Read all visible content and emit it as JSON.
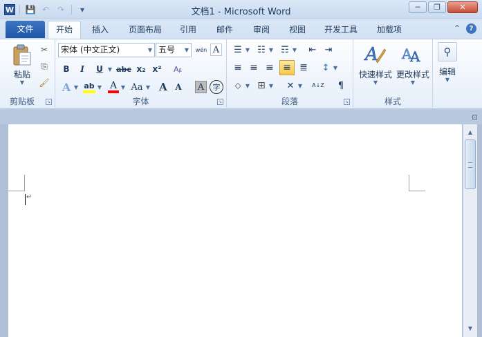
{
  "window": {
    "title": "文档1 - Microsoft Word",
    "app_icon_letter": "W"
  },
  "qat": {
    "save": "💾",
    "undo": "↶",
    "redo": "↷",
    "customize": "▾"
  },
  "window_controls": {
    "minimize": "─",
    "restore": "❐",
    "close": "✕"
  },
  "tabs": [
    {
      "label": "文件"
    },
    {
      "label": "开始"
    },
    {
      "label": "插入"
    },
    {
      "label": "页面布局"
    },
    {
      "label": "引用"
    },
    {
      "label": "邮件"
    },
    {
      "label": "审阅"
    },
    {
      "label": "视图"
    },
    {
      "label": "开发工具"
    },
    {
      "label": "加载项"
    }
  ],
  "tab_right": {
    "collapse": "⌃",
    "help": "?"
  },
  "clipboard": {
    "label": "剪贴板",
    "paste": "粘贴",
    "cut": "✂",
    "copy": "⎘",
    "format_painter": "🖌"
  },
  "font": {
    "label": "字体",
    "font_name": "宋体 (中文正文)",
    "font_size": "五号",
    "phonetic": "wén",
    "char_border": "A",
    "bold": "B",
    "italic": "I",
    "underline": "U",
    "strike": "abc",
    "subscript": "x₂",
    "superscript": "x²",
    "clear": "Aᵦ",
    "text_effect": "A",
    "highlight": "ab",
    "font_color": "A",
    "case": "Aa",
    "grow": "A",
    "shrink": "A",
    "shading": "A",
    "enclose": "字"
  },
  "paragraph": {
    "label": "段落",
    "bullets": "☰",
    "numbering": "☷",
    "multilevel": "☶",
    "decrease_indent": "⇤",
    "increase_indent": "⇥",
    "align_left": "≡",
    "center": "≡",
    "align_right": "≡",
    "justify": "≡",
    "distributed": "≣",
    "line_spacing": "↕",
    "shading": "⬦",
    "borders": "⊞",
    "chinese_layout": "✕",
    "sort": "A↓Z",
    "show_marks": "¶"
  },
  "styles": {
    "label": "样式",
    "quick_styles": "快速样式",
    "change_styles": "更改样式"
  },
  "editing": {
    "label": "编辑",
    "find_icon": "⚲"
  },
  "colors": {
    "accent": "#2b579a",
    "highlight_yellow": "#ffff00",
    "font_red": "#ff0000"
  }
}
